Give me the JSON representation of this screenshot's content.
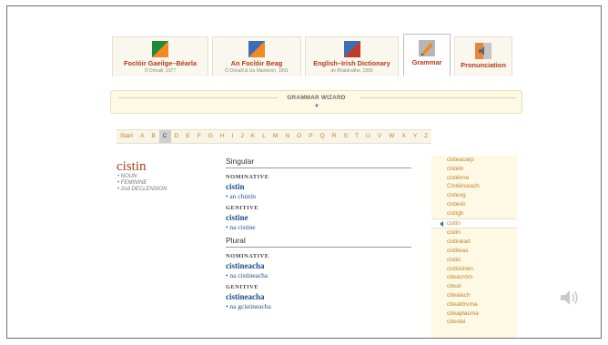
{
  "tabs": [
    {
      "name": "Foclóir Gaeilge–Béarla",
      "sub": "Ó Dónaill, 1977",
      "icon": "ireland-flag-icon"
    },
    {
      "name": "An Foclóir Beag",
      "sub": "Ó Dónaill & Ua Maoileoin, 1991",
      "icon": "ireland-flag-icon"
    },
    {
      "name": "English–Irish Dictionary",
      "sub": "de Bhaldraithe, 1959",
      "icon": "uk-flag-icon"
    },
    {
      "name": "Grammar",
      "sub": "",
      "icon": "grammar-pencil-icon"
    },
    {
      "name": "Pronunciation",
      "sub": "",
      "icon": "speaker-icon"
    }
  ],
  "wizard": {
    "title": "GRAMMAR WIZARD"
  },
  "alphabet": [
    "Start",
    "A",
    "B",
    "C",
    "D",
    "E",
    "F",
    "G",
    "H",
    "I",
    "J",
    "K",
    "L",
    "M",
    "N",
    "O",
    "P",
    "Q",
    "R",
    "S",
    "T",
    "U",
    "V",
    "W",
    "X",
    "Y",
    "Z"
  ],
  "selected_letter": "C",
  "entry": {
    "headword": "cistin",
    "grammar": [
      "• NOUN",
      "• FEMININE",
      "• 2nd DECLENSION"
    ]
  },
  "forms": {
    "singular_label": "Singular",
    "plural_label": "Plural",
    "singular": [
      {
        "case": "NOMINATIVE",
        "form": "cistin",
        "article": "• an chistin"
      },
      {
        "case": "GENITIVE",
        "form": "cistine",
        "article": "• na cistine"
      }
    ],
    "plural": [
      {
        "case": "NOMINATIVE",
        "form": "cistineacha",
        "article": "• na cistineacha"
      },
      {
        "case": "GENITIVE",
        "form": "cistineacha",
        "article": "• na gcistineacha"
      }
    ]
  },
  "word_list": [
    "cisteacarp",
    "cistéin",
    "cistéirne",
    "Cistéirseach",
    "cisteog",
    "cisteoir",
    "cistigh",
    "cistin",
    "cistin",
    "cistinéad",
    "cistiteas",
    "cistiú",
    "cistiúchén",
    "citeacróm",
    "citeal",
    "citealach",
    "citealdruma",
    "citeaplasma",
    "citeolai"
  ],
  "word_list_current_index": 7,
  "colors": {
    "link": "#c0832f",
    "headword": "#b23b1a",
    "form": "#1f4c8c",
    "wizard_bg": "#fdf9e4"
  }
}
